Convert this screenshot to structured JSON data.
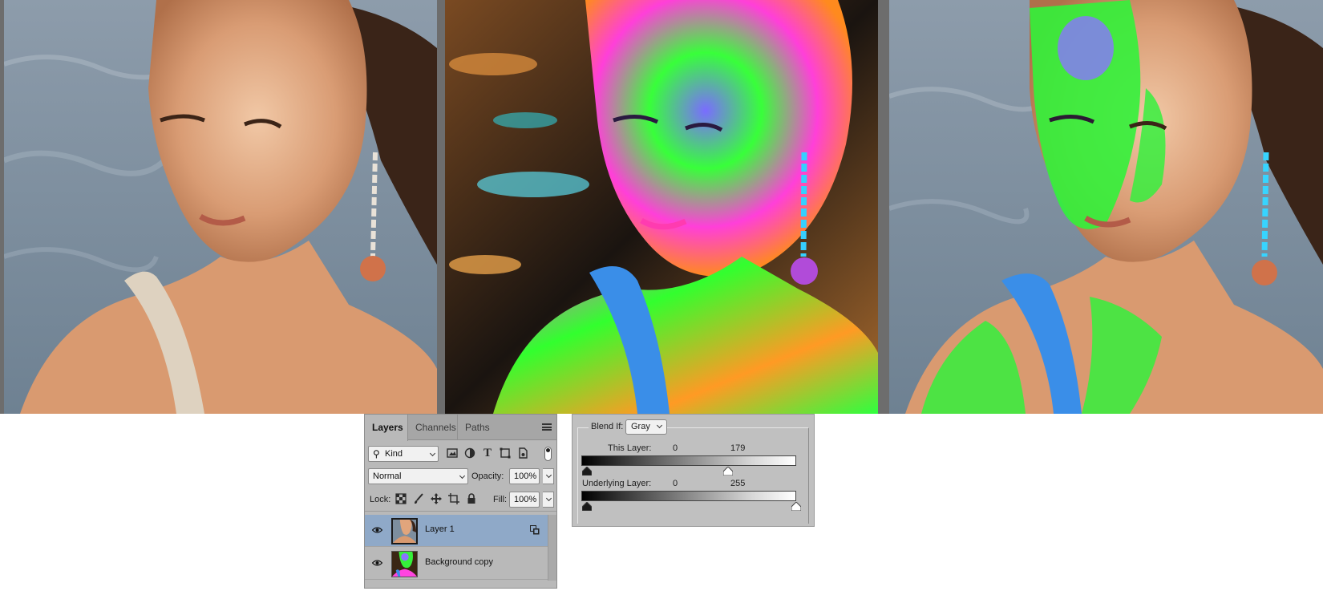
{
  "layers_panel": {
    "tabs": [
      {
        "label": "Layers",
        "active": true
      },
      {
        "label": "Channels",
        "active": false
      },
      {
        "label": "Paths",
        "active": false
      }
    ],
    "filter": {
      "label": "Kind",
      "icons": [
        "image-filter-icon",
        "adjustment-filter-icon",
        "type-filter-icon",
        "shape-filter-icon",
        "smart-object-filter-icon"
      ]
    },
    "blend_mode": "Normal",
    "opacity_label": "Opacity:",
    "opacity_value": "100%",
    "lock_label": "Lock:",
    "lock_icons": [
      "lock-transparent-pixels-icon",
      "lock-image-pixels-icon",
      "lock-position-icon",
      "lock-artboard-icon",
      "lock-all-icon"
    ],
    "fill_label": "Fill:",
    "fill_value": "100%",
    "layers": [
      {
        "name": "Layer 1",
        "visible": true,
        "selected": true,
        "blending_options_applied": true
      },
      {
        "name": "Background copy",
        "visible": true,
        "selected": false,
        "blending_options_applied": false
      }
    ]
  },
  "blend_if": {
    "label": "Blend If:",
    "channel": "Gray",
    "this_layer": {
      "label": "This Layer:",
      "low": "0",
      "high": "179"
    },
    "underlying_layer": {
      "label": "Underlying Layer:",
      "low": "0",
      "high": "255"
    }
  },
  "colors": {
    "layer_selected": "#8fa9c8",
    "panel_bg": "#b9b9b9",
    "image_divider": "#6d6d6d"
  }
}
